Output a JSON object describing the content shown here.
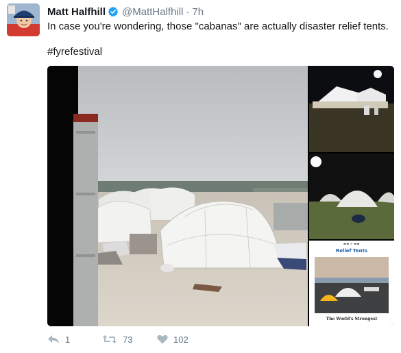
{
  "tweet": {
    "name": "Matt Halfhill",
    "handle": "@MattHalfhill",
    "separator": "·",
    "time": "7h",
    "text": "In case you're wondering, those \"cabanas\" are actually disaster relief tents.",
    "hashtag": "#fyrefestival",
    "verified_icon": "verified-badge-icon",
    "accent_color": "#1da1f2"
  },
  "media": {
    "document_header": "▬▬ ᐱ ▬▬",
    "document_title": "Relief Tents",
    "document_caption": "The World's Strongest"
  },
  "actions": {
    "reply_count": "1",
    "retweet_count": "73",
    "like_count": "102",
    "reply_icon": "reply-icon",
    "retweet_icon": "retweet-icon",
    "like_icon": "heart-icon"
  }
}
